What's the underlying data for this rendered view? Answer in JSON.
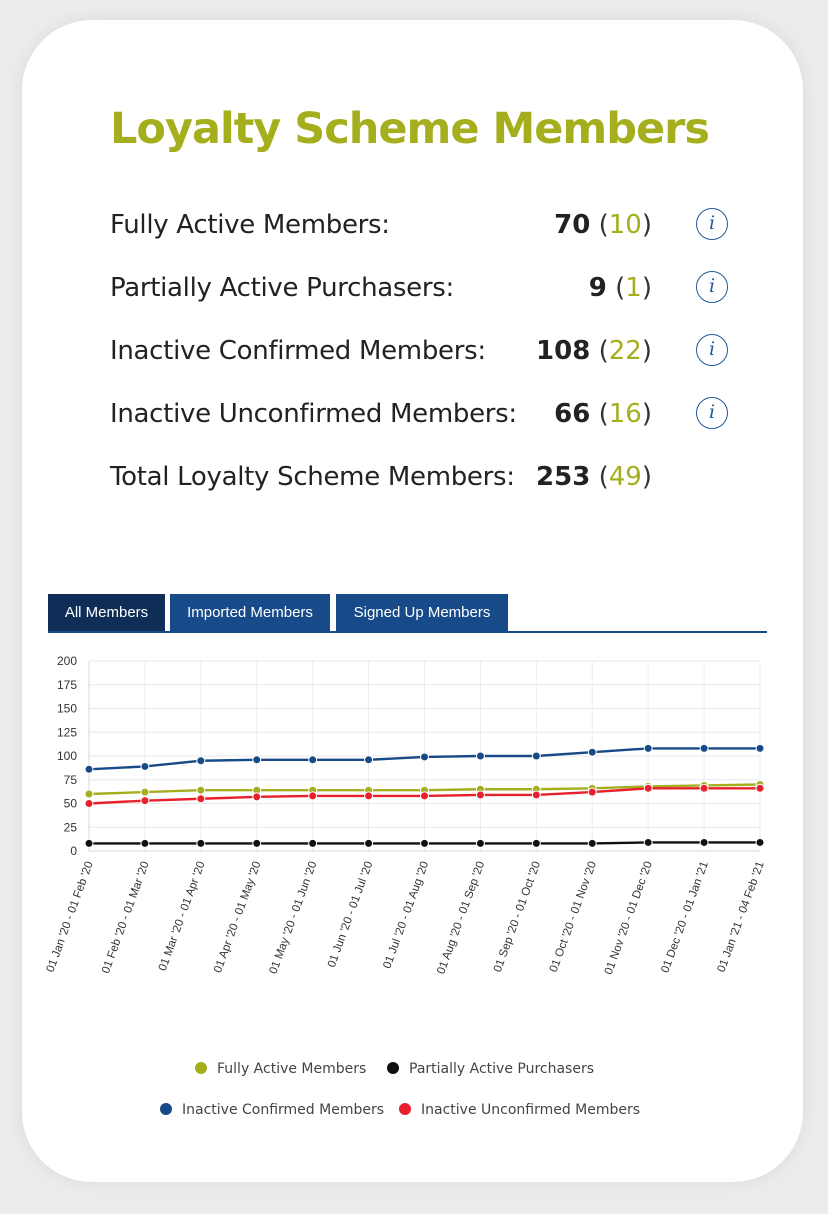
{
  "title": "Loyalty Scheme Members",
  "stats": [
    {
      "label": "Fully Active Members:",
      "count": "70",
      "delta": "10",
      "info": "i"
    },
    {
      "label": "Partially Active Purchasers:",
      "count": "9",
      "delta": "1",
      "info": "i"
    },
    {
      "label": "Inactive Confirmed Members:",
      "count": "108",
      "delta": "22",
      "info": "i"
    },
    {
      "label": "Inactive Unconfirmed Members:",
      "count": "66",
      "delta": "16",
      "info": "i"
    },
    {
      "label": "Total Loyalty Scheme Members:",
      "count": "253",
      "delta": "49"
    }
  ],
  "tabs": [
    {
      "label": "All Members",
      "active": true
    },
    {
      "label": "Imported Members",
      "active": false
    },
    {
      "label": "Signed Up Members",
      "active": false
    }
  ],
  "colors": {
    "accent": "#a5ae1c",
    "tab": "#174a88",
    "tab_active": "#0e2d57",
    "info": "#1e5a9a"
  },
  "chart_data": {
    "type": "line",
    "categories": [
      "01 Jan '20 - 01 Feb '20",
      "01 Feb '20 - 01 Mar '20",
      "01 Mar '20 - 01 Apr '20",
      "01 Apr '20 - 01 May '20",
      "01 May '20 - 01 Jun '20",
      "01 Jun '20 - 01 Jul '20",
      "01 Jul '20 - 01 Aug '20",
      "01 Aug '20 - 01 Sep '20",
      "01 Sep '20 - 01 Oct '20",
      "01 Oct '20 - 01 Nov '20",
      "01 Nov '20 - 01 Dec '20",
      "01 Dec '20 - 01 Jan '21",
      "01 Jan '21 - 04 Feb '21"
    ],
    "yticks": [
      "0",
      "25",
      "50",
      "75",
      "100",
      "125",
      "150",
      "175",
      "200"
    ],
    "ylim": [
      0,
      200
    ],
    "grid": true,
    "legend_position": "bottom",
    "series": [
      {
        "name": "Fully Active Members",
        "color": "#a5ae1c",
        "values": [
          60,
          62,
          64,
          64,
          64,
          64,
          64,
          65,
          65,
          66,
          68,
          69,
          70
        ]
      },
      {
        "name": "Partially Active Purchasers",
        "color": "#111111",
        "values": [
          8,
          8,
          8,
          8,
          8,
          8,
          8,
          8,
          8,
          8,
          9,
          9,
          9
        ]
      },
      {
        "name": "Inactive Confirmed Members",
        "color": "#174a88",
        "values": [
          86,
          89,
          95,
          96,
          96,
          96,
          99,
          100,
          100,
          104,
          108,
          108,
          108
        ]
      },
      {
        "name": "Inactive Unconfirmed Members",
        "color": "#e8202b",
        "values": [
          50,
          53,
          55,
          57,
          58,
          58,
          58,
          59,
          59,
          62,
          66,
          66,
          66
        ]
      }
    ]
  }
}
